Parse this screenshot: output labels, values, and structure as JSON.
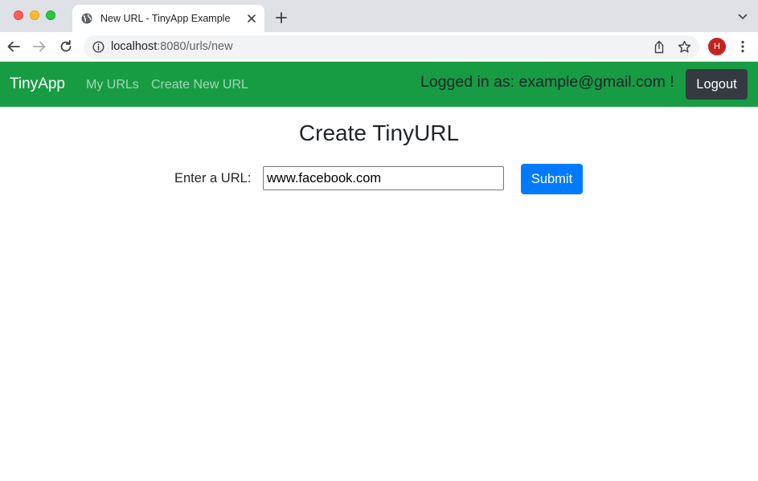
{
  "browser": {
    "tab_title": "New URL - TinyApp Example",
    "url_host": "localhost",
    "url_rest": ":8080/urls/new",
    "profile_initial": "H",
    "profile_color": "#c5221f"
  },
  "navbar": {
    "brand": "TinyApp",
    "links": [
      "My URLs",
      "Create New URL"
    ],
    "logged_in_text": "Logged in as: example@gmail.com !",
    "logout_label": "Logout",
    "background_color": "#179c43"
  },
  "main": {
    "title": "Create TinyURL",
    "field_label": "Enter a URL:",
    "url_value": "www.facebook.com",
    "submit_label": "Submit",
    "submit_color": "#007bff"
  }
}
